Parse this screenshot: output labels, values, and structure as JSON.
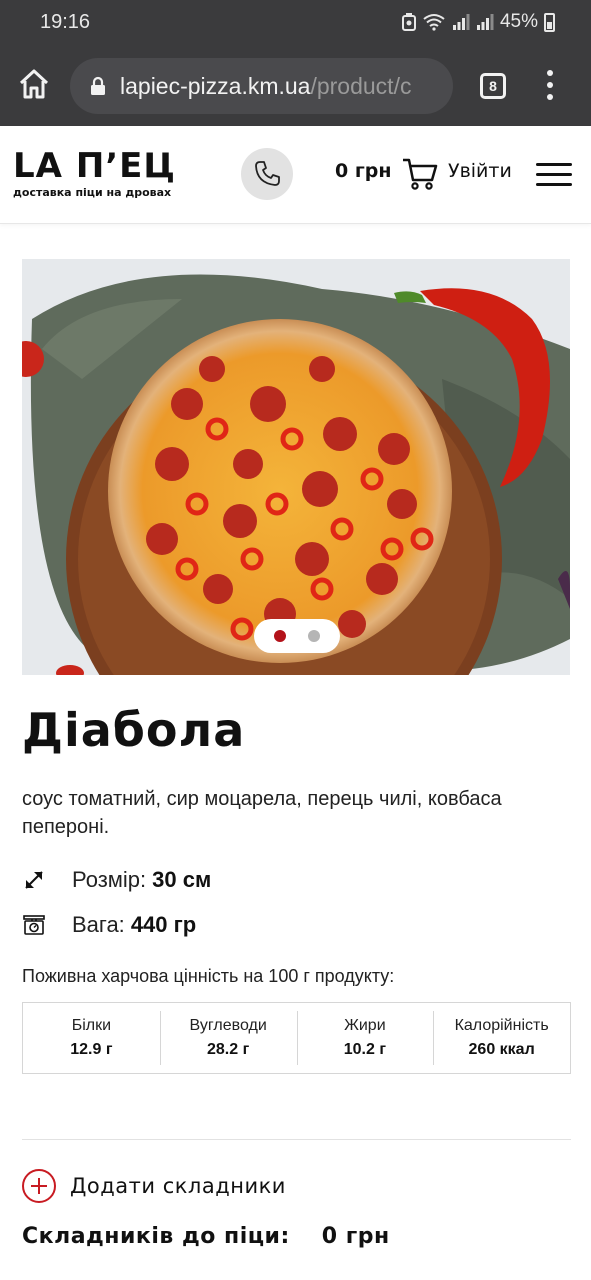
{
  "status_bar": {
    "time": "19:16",
    "battery": "45%",
    "icons": [
      "data-saver-icon",
      "wifi-icon",
      "signal-icon",
      "signal-icon",
      "battery-icon"
    ]
  },
  "browser": {
    "url_domain": "lapiec-pizza.km.ua",
    "url_path": "/product/c",
    "tab_count": "8"
  },
  "header": {
    "logo_main": "LA П’ЕЦ",
    "logo_sub": "доставка піци на дровах",
    "cart_price": "0 грн",
    "login_label": "Увійти"
  },
  "slider": {
    "slide_count": 2,
    "active_index": 0
  },
  "product": {
    "title": "Діабола",
    "description": "соус томатний, сир моцарела, перець чилі, ковбаса пепероні.",
    "size_label": "Розмір:",
    "size_value": "30 см",
    "weight_label": "Вага:",
    "weight_value": "440 гр"
  },
  "nutrition": {
    "title": "Поживна харчова цінність на 100 г продукту:",
    "items": [
      {
        "label": "Білки",
        "value": "12.9 г"
      },
      {
        "label": "Вуглеводи",
        "value": "28.2 г"
      },
      {
        "label": "Жири",
        "value": "10.2 г"
      },
      {
        "label": "Калорійність",
        "value": "260 ккал"
      }
    ]
  },
  "extras": {
    "add_label": "Додати складники",
    "total_label": "Складників до піци:",
    "total_price": "0 грн"
  },
  "colors": {
    "status_bg": "#3b3b3d",
    "accent_red": "#c81b22",
    "dot_active": "#b3121a"
  }
}
